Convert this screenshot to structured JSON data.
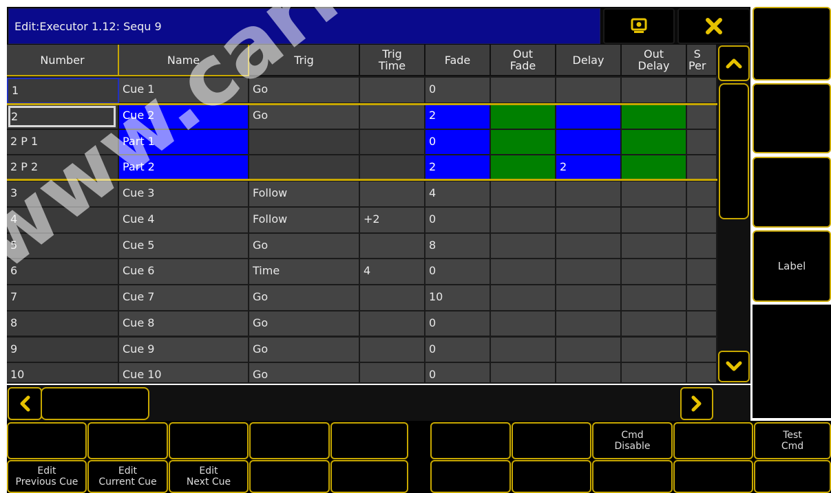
{
  "window": {
    "title": "Edit:Executor 1.12: Sequ 9"
  },
  "title_buttons": {
    "view_icon": "screen-icon",
    "close_icon": "close-icon"
  },
  "columns": [
    "Number",
    "Name",
    "Trig",
    "Trig\nTime",
    "Fade",
    "Out\nFade",
    "Delay",
    "Out\nDelay",
    "S\nPer"
  ],
  "rows": [
    {
      "number": "1",
      "name": "Cue 1",
      "trig": "Go",
      "trig_time": "",
      "fade": "0",
      "out_fade": "",
      "delay": "",
      "out_delay": "",
      "style": "normal"
    },
    {
      "number": "2",
      "name": "Cue 2",
      "trig": "Go",
      "trig_time": "",
      "fade": "2",
      "out_fade": "",
      "delay": "",
      "out_delay": "",
      "style": "current"
    },
    {
      "number": "2 P 1",
      "name": "Part 1",
      "trig": "",
      "trig_time": "",
      "fade": "0",
      "out_fade": "",
      "delay": "",
      "out_delay": "",
      "style": "part"
    },
    {
      "number": "2 P 2",
      "name": "Part 2",
      "trig": "",
      "trig_time": "",
      "fade": "2",
      "out_fade": "",
      "delay": "2",
      "out_delay": "",
      "style": "part"
    },
    {
      "number": "3",
      "name": "Cue 3",
      "trig": "Follow",
      "trig_time": "",
      "fade": "4",
      "out_fade": "",
      "delay": "",
      "out_delay": "",
      "style": "normal"
    },
    {
      "number": "4",
      "name": "Cue 4",
      "trig": "Follow",
      "trig_time": "+2",
      "fade": "0",
      "out_fade": "",
      "delay": "",
      "out_delay": "",
      "style": "normal"
    },
    {
      "number": "5",
      "name": "Cue 5",
      "trig": "Go",
      "trig_time": "",
      "fade": "8",
      "out_fade": "",
      "delay": "",
      "out_delay": "",
      "style": "normal"
    },
    {
      "number": "6",
      "name": "Cue 6",
      "trig": "Time",
      "trig_time": "4",
      "fade": "0",
      "out_fade": "",
      "delay": "",
      "out_delay": "",
      "style": "normal"
    },
    {
      "number": "7",
      "name": "Cue 7",
      "trig": "Go",
      "trig_time": "",
      "fade": "10",
      "out_fade": "",
      "delay": "",
      "out_delay": "",
      "style": "normal"
    },
    {
      "number": "8",
      "name": "Cue 8",
      "trig": "Go",
      "trig_time": "",
      "fade": "0",
      "out_fade": "",
      "delay": "",
      "out_delay": "",
      "style": "normal"
    },
    {
      "number": "9",
      "name": "Cue 9",
      "trig": "Go",
      "trig_time": "",
      "fade": "0",
      "out_fade": "",
      "delay": "",
      "out_delay": "",
      "style": "normal"
    },
    {
      "number": "10",
      "name": "Cue 10",
      "trig": "Go",
      "trig_time": "",
      "fade": "0",
      "out_fade": "",
      "delay": "",
      "out_delay": "",
      "style": "normal"
    }
  ],
  "side_panel": [
    "",
    "",
    "",
    "Label",
    ""
  ],
  "bottom_row1": [
    "",
    "",
    "",
    "",
    "",
    "",
    "",
    "Cmd\nDisable",
    "",
    "Test\nCmd"
  ],
  "bottom_row2": [
    "Edit\nPrevious Cue",
    "Edit\nCurrent Cue",
    "Edit\nNext Cue",
    "",
    "",
    "",
    "",
    "",
    "",
    ""
  ],
  "watermark": "www.carlosmel",
  "colors": {
    "title_bg": "#0a0a8c",
    "accent": "#c8a800",
    "selected": "#0000ff",
    "green": "#008000"
  }
}
